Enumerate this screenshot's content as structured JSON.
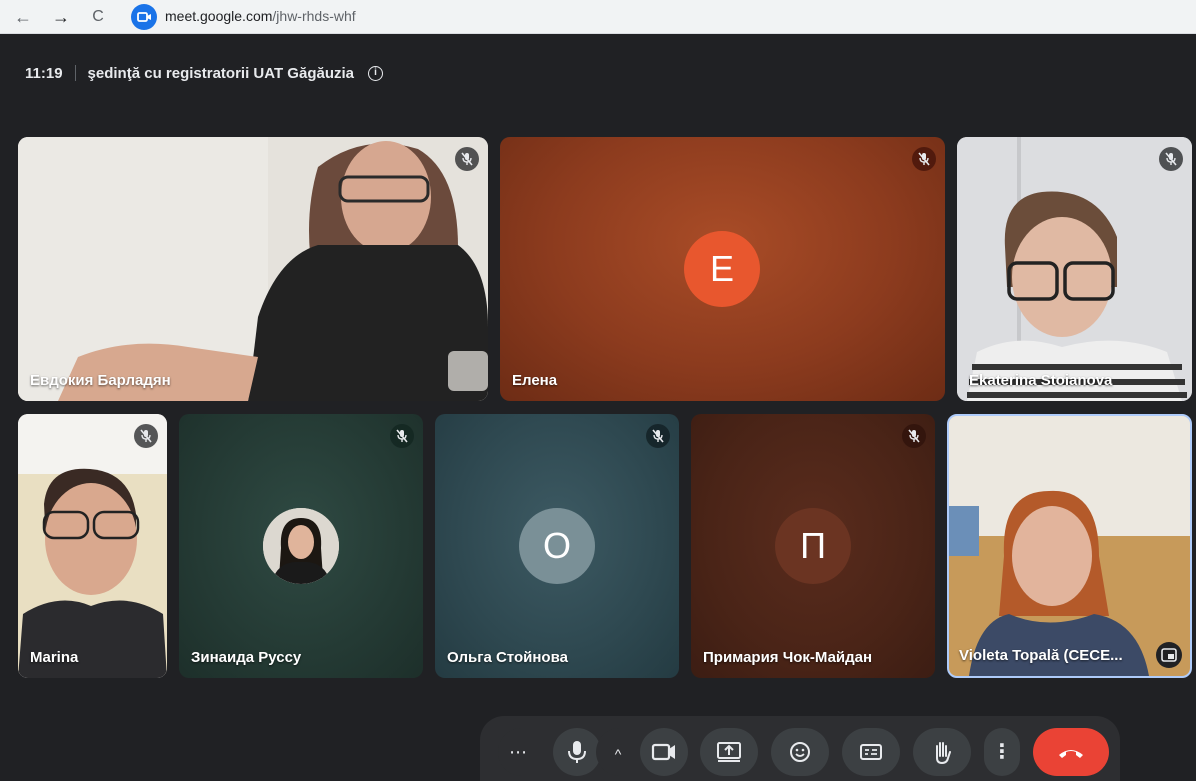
{
  "browser": {
    "back_icon": "←",
    "forward_icon": "→",
    "reload_icon": "C",
    "url_host": "meet.google.com",
    "url_path": "/jhw-rhds-whf"
  },
  "meeting": {
    "time": "11:19",
    "title": "şedinţă cu registratorii UAT Găgăuzia",
    "info_icon": "i"
  },
  "participants": [
    {
      "name": "Евдокия Барладян",
      "muted": true
    },
    {
      "name": "Елена",
      "muted": true,
      "initial": "E"
    },
    {
      "name": "Ekaterina Stoianova",
      "muted": true
    },
    {
      "name": "Marina",
      "muted": true
    },
    {
      "name": "Зинаида Руссу",
      "muted": true
    },
    {
      "name": "Ольга Стойнова",
      "muted": true,
      "initial": "О"
    },
    {
      "name": "Примария Чок-Майдан",
      "muted": true,
      "initial": "П"
    },
    {
      "name": "Violeta Topală (CECE...",
      "muted": false
    }
  ],
  "controls": {
    "more_options": "⋯",
    "caret": "^",
    "more_vert": "⋮"
  },
  "colors": {
    "accent": "#1a73e8",
    "end_call": "#ea4335",
    "avatar_e": "#e8572e",
    "avatar_o": "#7a9097",
    "avatar_p": "#6b3422"
  }
}
